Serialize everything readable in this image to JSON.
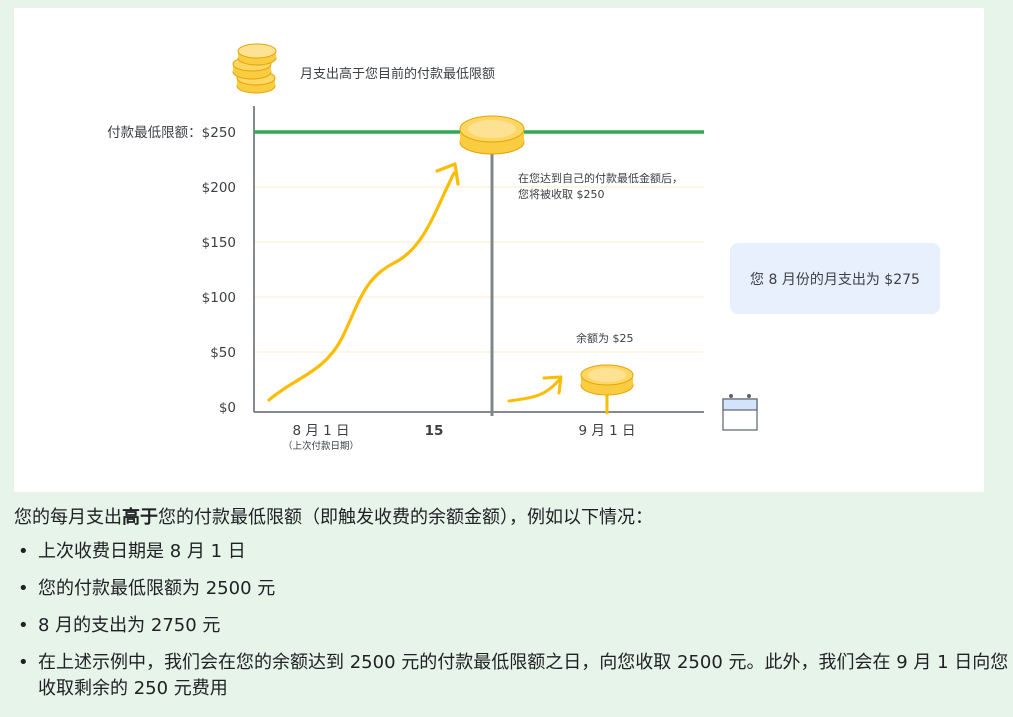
{
  "figure": {
    "legend_label": "月支出高于您目前的付款最低限额",
    "threshold_label": "付款最低限额：$250",
    "y_ticks": [
      "$200",
      "$150",
      "$100",
      "$50",
      "$0"
    ],
    "x_tick_start": "8 月 1 日",
    "x_tick_start_sub": "（上次付款日期）",
    "x_tick_mid": "15",
    "x_tick_end": "9 月 1 日",
    "annotation_charge_line1": "在您达到自己的付款最低金额后，",
    "annotation_charge_line2": "您将被收取 $250",
    "annotation_balance": "余额为 $25",
    "callout_text": "您 8 月份的月支出为 $275",
    "colors": {
      "threshold_line": "#34a853",
      "spend_curve": "#fbbc04",
      "coin": "#fdd663",
      "divider": "#80868b"
    },
    "icons": [
      "coins-stack-icon",
      "coin-icon",
      "arrow-icon",
      "calendar-icon"
    ]
  },
  "text": {
    "intro_before": "您的每月支出",
    "intro_bold": "高于",
    "intro_after": "您的付款最低限额（即触发收费的余额金额），例如以下情况：",
    "bullets": [
      "上次收费日期是 8 月 1 日",
      "您的付款最低限额为 2500 元",
      "8 月的支出为 2750 元",
      "在上述示例中，我们会在您的余额达到 2500 元的付款最低限额之日，向您收取 2500 元。此外，我们会在 9 月 1 日向您收取剩余的 250 元费用"
    ]
  }
}
